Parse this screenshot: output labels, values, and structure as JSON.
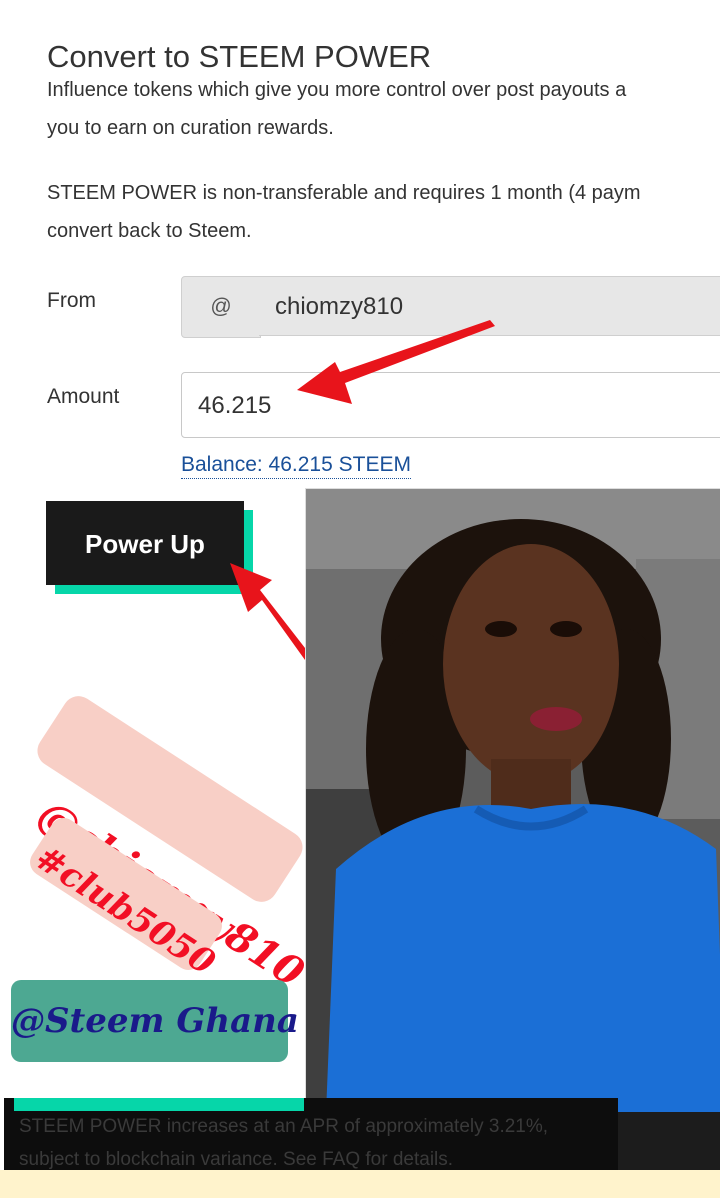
{
  "header": {
    "title": "Convert to STEEM POWER"
  },
  "description": {
    "para1_line1": "Influence tokens which give you more control over post payouts a",
    "para1_line2": "you to earn on curation rewards.",
    "para2_line1": "STEEM POWER is non-transferable and requires 1 month (4 paym",
    "para2_line2": "convert back to Steem."
  },
  "form": {
    "from_label": "From",
    "at_symbol": "@",
    "from_value": "chiomzy810",
    "amount_label": "Amount",
    "amount_value": "46.215",
    "balance_text": "Balance: 46.215 STEEM",
    "submit_label": "Power Up"
  },
  "stickers": {
    "username": "@chiomzy810",
    "hashtag": "#club5050",
    "community": "@Steem Ghana"
  },
  "footer": {
    "apr_line1": "STEEM POWER increases at an APR of approximately 3.21%,",
    "apr_line2": "subject to blockchain variance. See FAQ for details."
  },
  "colors": {
    "accent": "#06d6a9",
    "button_bg": "#1a1a1a",
    "link": "#1a5099",
    "arrow": "#e8141b",
    "sticker_text": "#f20f24",
    "sticker_bg": "#f8cfc6",
    "ghana_bg": "#4da892",
    "ghana_text": "#1a1a8a",
    "photo_subject_shirt": "#1b6fd6"
  },
  "icons": {
    "arrow_from": "red-arrow-icon",
    "arrow_button": "red-arrow-icon"
  }
}
